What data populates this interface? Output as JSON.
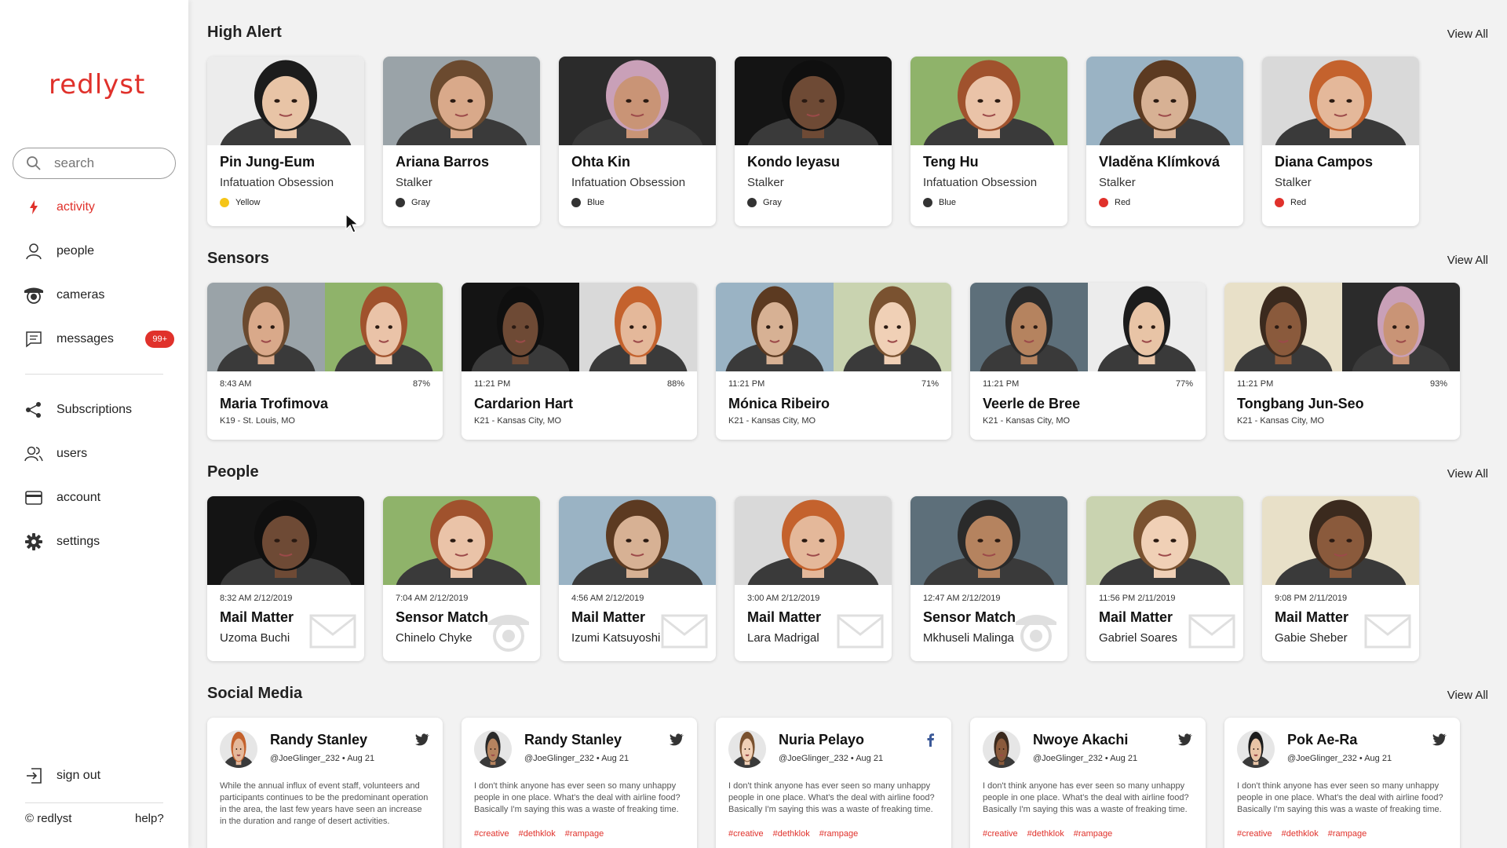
{
  "app": {
    "logo": "redlyst",
    "accent": "#e0312b"
  },
  "search": {
    "placeholder": "search"
  },
  "nav": {
    "primary": [
      {
        "label": "activity",
        "icon": "bolt-icon",
        "active": true
      },
      {
        "label": "people",
        "icon": "person-icon"
      },
      {
        "label": "cameras",
        "icon": "camera-icon"
      },
      {
        "label": "messages",
        "icon": "message-icon",
        "badge": "99+"
      }
    ],
    "secondary": [
      {
        "label": "Subscriptions",
        "icon": "share-icon"
      },
      {
        "label": "users",
        "icon": "users-icon"
      },
      {
        "label": "account",
        "icon": "card-icon"
      },
      {
        "label": "settings",
        "icon": "gear-icon"
      }
    ],
    "signout": "sign out"
  },
  "footer": {
    "copyright": "© redlyst",
    "help": "help?"
  },
  "view_all": "View All",
  "high_alert": {
    "title": "High Alert",
    "cards": [
      {
        "name": "Pin Jung-Eum",
        "type": "Infatuation Obsession",
        "level": "Yellow",
        "color": "#f5c518"
      },
      {
        "name": "Ariana Barros",
        "type": "Stalker",
        "level": "Gray",
        "color": "#333333"
      },
      {
        "name": "Ohta Kin",
        "type": "Infatuation Obsession",
        "level": "Blue",
        "color": "#333333"
      },
      {
        "name": "Kondo Ieyasu",
        "type": "Stalker",
        "level": "Gray",
        "color": "#333333"
      },
      {
        "name": "Teng Hu",
        "type": "Infatuation Obsession",
        "level": "Blue",
        "color": "#333333"
      },
      {
        "name": "Vladěna Klímková",
        "type": "Stalker",
        "level": "Red",
        "color": "#e0312b"
      },
      {
        "name": "Diana Campos",
        "type": "Stalker",
        "level": "Red",
        "color": "#e0312b"
      }
    ]
  },
  "sensors": {
    "title": "Sensors",
    "cards": [
      {
        "time": "8:43 AM",
        "pct": "87%",
        "name": "Maria Trofimova",
        "loc": "K19 - St. Louis, MO"
      },
      {
        "time": "11:21 PM",
        "pct": "88%",
        "name": "Cardarion Hart",
        "loc": "K21 - Kansas City, MO"
      },
      {
        "time": "11:21 PM",
        "pct": "71%",
        "name": "Mónica Ribeiro",
        "loc": "K21 - Kansas City, MO"
      },
      {
        "time": "11:21 PM",
        "pct": "77%",
        "name": "Veerle de Bree",
        "loc": "K21 - Kansas City, MO"
      },
      {
        "time": "11:21 PM",
        "pct": "93%",
        "name": "Tongbang Jun-Seo",
        "loc": "K21 - Kansas City, MO"
      }
    ]
  },
  "people": {
    "title": "People",
    "cards": [
      {
        "time": "8:32 AM 2/12/2019",
        "title": "Mail Matter",
        "name": "Uzoma Buchi",
        "icon": "mail-icon"
      },
      {
        "time": "7:04 AM 2/12/2019",
        "title": "Sensor Match",
        "name": "Chinelo Chyke",
        "icon": "camera-icon"
      },
      {
        "time": "4:56 AM 2/12/2019",
        "title": "Mail Matter",
        "name": "Izumi Katsuyoshi",
        "icon": "mail-icon"
      },
      {
        "time": "3:00 AM 2/12/2019",
        "title": "Mail Matter",
        "name": "Lara Madrigal",
        "icon": "mail-icon"
      },
      {
        "time": "12:47 AM 2/12/2019",
        "title": "Sensor Match",
        "name": "Mkhuseli Malinga",
        "icon": "camera-icon"
      },
      {
        "time": "11:56 PM 2/11/2019",
        "title": "Mail Matter",
        "name": "Gabriel Soares",
        "icon": "mail-icon"
      },
      {
        "time": "9:08 PM 2/11/2019",
        "title": "Mail Matter",
        "name": "Gabie Sheber",
        "icon": "mail-icon"
      }
    ]
  },
  "social": {
    "title": "Social Media",
    "cards": [
      {
        "name": "Randy Stanley",
        "handle": "@JoeGlinger_232",
        "date": "Aug 21",
        "network": "twitter-icon",
        "text": "While the annual influx of event staff, volunteers and participants continues to be the predominant operation in the area, the last few years have seen an increase in the duration and range of desert activities.",
        "tags": []
      },
      {
        "name": "Randy Stanley",
        "handle": "@JoeGlinger_232",
        "date": "Aug 21",
        "network": "twitter-icon",
        "text": "I don't think anyone has ever seen so many unhappy people in one place.  What's the deal with airline food? Basically I'm saying this was a waste of freaking time.",
        "tags": [
          "#creative",
          "#dethklok",
          "#rampage"
        ]
      },
      {
        "name": "Nuria Pelayo",
        "handle": "@JoeGlinger_232",
        "date": "Aug 21",
        "network": "facebook-icon",
        "text": "I don't think anyone has ever seen so many unhappy people in one place.  What's the deal with airline food? Basically I'm saying this was a waste of freaking time.",
        "tags": [
          "#creative",
          "#dethklok",
          "#rampage"
        ]
      },
      {
        "name": "Nwoye Akachi",
        "handle": "@JoeGlinger_232",
        "date": "Aug 21",
        "network": "twitter-icon",
        "text": "I don't think anyone has ever seen so many unhappy people in one place.  What's the deal with airline food? Basically I'm saying this was a waste of freaking time.",
        "tags": [
          "#creative",
          "#dethklok",
          "#rampage"
        ]
      },
      {
        "name": "Pok Ae-Ra",
        "handle": "@JoeGlinger_232",
        "date": "Aug 21",
        "network": "twitter-icon",
        "text": "I don't think anyone has ever seen so many unhappy people in one place.  What's the deal with airline food? Basically I'm saying this was a waste of freaking time.",
        "tags": [
          "#creative",
          "#dethklok",
          "#rampage"
        ]
      }
    ]
  }
}
